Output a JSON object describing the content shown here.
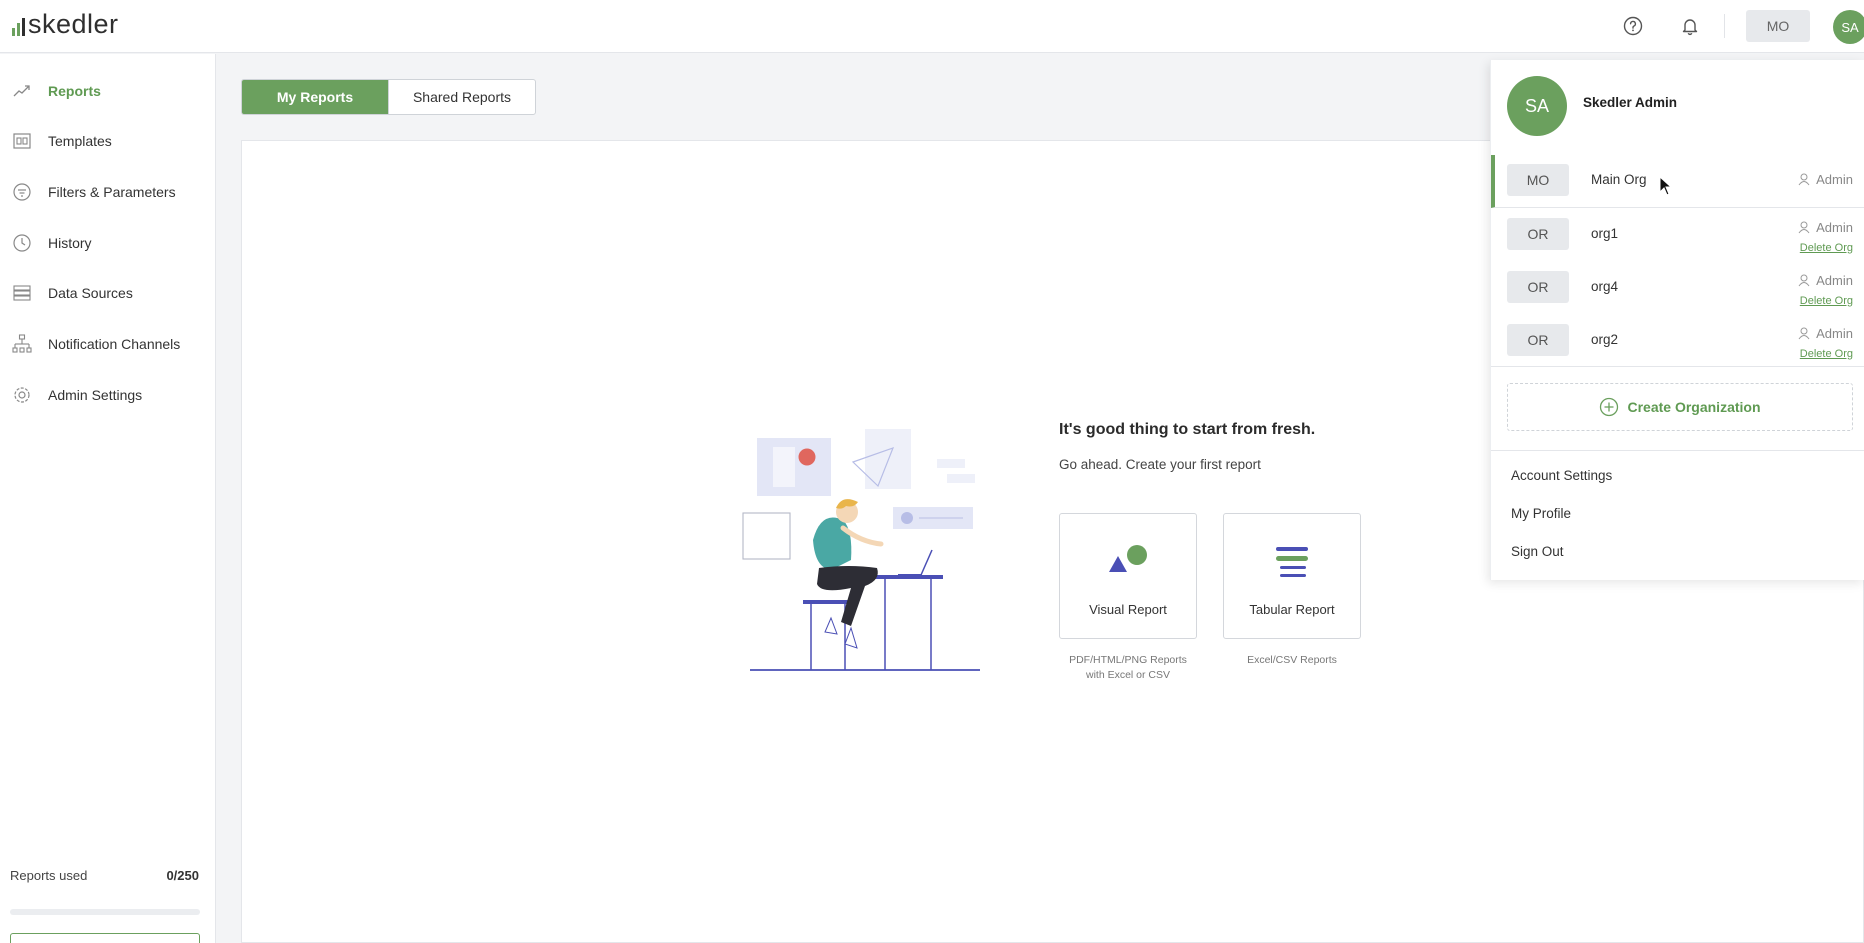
{
  "app": {
    "logo_text": "skedler"
  },
  "header": {
    "org_badge": "MO",
    "avatar_initials": "SA",
    "help_icon": "help-icon",
    "bell_icon": "bell-icon"
  },
  "sidebar": {
    "items": [
      {
        "label": "Reports",
        "icon": "trend-up-icon",
        "active": true
      },
      {
        "label": "Templates",
        "icon": "template-icon"
      },
      {
        "label": "Filters & Parameters",
        "icon": "filter-icon"
      },
      {
        "label": "History",
        "icon": "clock-icon"
      },
      {
        "label": "Data Sources",
        "icon": "database-icon"
      },
      {
        "label": "Notification Channels",
        "icon": "hierarchy-icon"
      },
      {
        "label": "Admin Settings",
        "icon": "gear-icon"
      }
    ],
    "usage": {
      "label": "Reports used",
      "count": "0/250",
      "fraction": 0
    }
  },
  "tabs": {
    "my_reports": "My Reports",
    "shared_reports": "Shared Reports",
    "active": "my_reports"
  },
  "empty_state": {
    "title": "It's good thing to start from fresh.",
    "subtitle": "Go ahead. Create your first report",
    "cards": [
      {
        "label": "Visual Report",
        "description": "PDF/HTML/PNG Reports with Excel or CSV"
      },
      {
        "label": "Tabular Report",
        "description": "Excel/CSV Reports"
      }
    ]
  },
  "account_menu": {
    "avatar_initials": "SA",
    "user_name": "Skedler Admin",
    "orgs": [
      {
        "badge": "MO",
        "name": "Main Org",
        "role": "Admin",
        "current": true
      },
      {
        "badge": "OR",
        "name": "org1",
        "role": "Admin",
        "delete_label": "Delete Org"
      },
      {
        "badge": "OR",
        "name": "org4",
        "role": "Admin",
        "delete_label": "Delete Org"
      },
      {
        "badge": "OR",
        "name": "org2",
        "role": "Admin",
        "delete_label": "Delete Org"
      }
    ],
    "create_label": "Create Organization",
    "links": {
      "account_settings": "Account Settings",
      "my_profile": "My Profile",
      "sign_out": "Sign Out"
    }
  },
  "colors": {
    "accent": "#6ba05e",
    "accent_text": "#5f9a52",
    "illustration_blue": "#4a4fb5",
    "illustration_red": "#e0675e"
  }
}
